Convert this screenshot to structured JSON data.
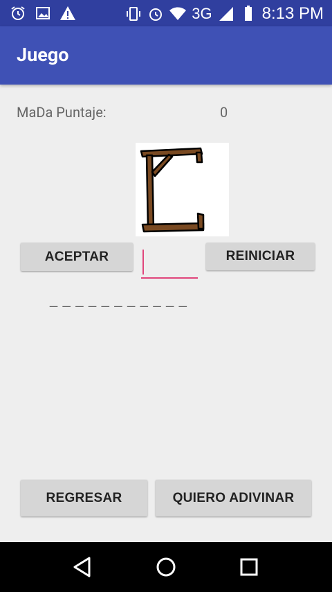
{
  "status_bar": {
    "network": "3G",
    "time": "8:13 PM",
    "icons": [
      "alarm-icon",
      "image-icon",
      "warning-icon",
      "vibrate-icon",
      "alarm-icon",
      "wifi-icon",
      "signal-icon",
      "battery-icon"
    ]
  },
  "app_bar": {
    "title": "Juego"
  },
  "score": {
    "label": "MaDa Puntaje:",
    "value": "0"
  },
  "buttons": {
    "accept": "ACEPTAR",
    "reset": "REINICIAR",
    "back": "REGRESAR",
    "guess": "QUIERO ADIVINAR"
  },
  "letter_input": {
    "value": ""
  },
  "word_display": "_ _ _ _ _ _ _ _ _ _ _",
  "nav_bar": {
    "icons": [
      "back-icon",
      "home-icon",
      "recents-icon"
    ]
  },
  "colors": {
    "status_bar": "#303f9f",
    "app_bar": "#3f51b5",
    "accent": "#e0457b",
    "background": "#eeeeee",
    "button": "#d6d6d6",
    "gallows_wood": "#7a4a22"
  }
}
